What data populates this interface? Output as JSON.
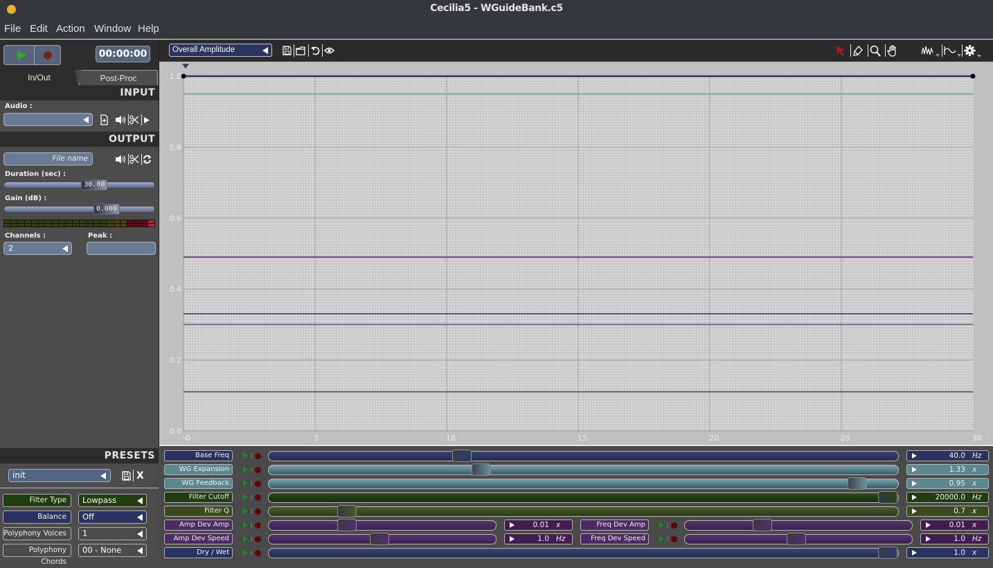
{
  "window": {
    "title": "Cecilia5 - WGuideBank.c5"
  },
  "menu": [
    "File",
    "Edit",
    "Action",
    "Window",
    "Help"
  ],
  "transport": {
    "time": "00:00:00",
    "play_icon": "play-icon",
    "record_icon": "record-icon"
  },
  "tabs": [
    {
      "label": "In/Out",
      "active": true
    },
    {
      "label": "Post-Proc",
      "active": false
    }
  ],
  "input": {
    "header": "INPUT",
    "audio_label": "Audio :",
    "audio_value": ""
  },
  "output": {
    "header": "OUTPUT",
    "filename_placeholder": "File name",
    "duration_label": "Duration (sec) :",
    "duration_value": "30.00",
    "duration_position": 0.6,
    "gain_label": "Gain (dB) :",
    "gain_value": "0.000",
    "gain_position": 0.68,
    "channels_label": "Channels :",
    "channels_value": "2",
    "peak_label": "Peak :",
    "peak_value": ""
  },
  "graph": {
    "selector": "Overall Amplitude",
    "xlim": [
      0,
      30
    ],
    "ylim": [
      0,
      1
    ],
    "x_ticks": [
      {
        "v": 0,
        "label": "-0"
      },
      {
        "v": 5,
        "label": "5"
      },
      {
        "v": 10,
        "label": "10"
      },
      {
        "v": 15,
        "label": "15"
      },
      {
        "v": 20,
        "label": "20"
      },
      {
        "v": 25,
        "label": "25"
      },
      {
        "v": 30,
        "label": "30"
      }
    ],
    "y_ticks": [
      {
        "v": 1.0,
        "label": "1.0"
      },
      {
        "v": 0.8,
        "label": "0.8"
      },
      {
        "v": 0.6,
        "label": "0.6"
      },
      {
        "v": 0.4,
        "label": "0.4"
      },
      {
        "v": 0.2,
        "label": "0.2"
      },
      {
        "v": 0.0,
        "label": "0.0"
      }
    ],
    "lines": [
      {
        "name": "overall-amplitude",
        "value": 1.0,
        "color": "#2e3462",
        "endpoints": true
      },
      {
        "name": "wg-feedback",
        "value": 0.95,
        "color": "#86a4ac",
        "endpoints": false
      },
      {
        "name": "purple-line",
        "value": 0.49,
        "color": "#6c4a80",
        "endpoints": false
      },
      {
        "name": "slate-line-1",
        "value": 0.33,
        "color": "#505a78",
        "endpoints": false
      },
      {
        "name": "slate-line-2",
        "value": 0.3,
        "color": "#6a6e92",
        "endpoints": false
      },
      {
        "name": "olive-line",
        "value": 0.11,
        "color": "#5b6a45",
        "endpoints": false
      }
    ]
  },
  "presets": {
    "header": "PRESETS",
    "value": "init",
    "delete_label": "X"
  },
  "widgets": [
    {
      "label": "Filter Type",
      "value": "Lowpass",
      "theme": "green"
    },
    {
      "label": "Balance",
      "value": "Off",
      "theme": "navy"
    },
    {
      "label": "Polyphony Voices",
      "value": "1",
      "theme": "none"
    },
    {
      "label": "Polyphony Chords",
      "value": "00 - None",
      "theme": "none"
    }
  ],
  "sliders": {
    "rows": [
      [
        {
          "label": "Base Freq",
          "value": "40.0",
          "unit": "Hz",
          "position": 0.307,
          "theme": "navy"
        }
      ],
      [
        {
          "label": "WG Expansion",
          "value": "1.33",
          "unit": "x",
          "position": 0.337,
          "theme": "teal"
        }
      ],
      [
        {
          "label": "WG Feedback",
          "value": "0.95",
          "unit": "x",
          "position": 0.936,
          "theme": "teal"
        }
      ],
      [
        {
          "label": "Filter Cutoff",
          "value": "20000.0",
          "unit": "Hz",
          "position": 0.985,
          "theme": "green"
        }
      ],
      [
        {
          "label": "Filter Q",
          "value": "0.7",
          "unit": "x",
          "position": 0.124,
          "theme": "olive"
        }
      ],
      [
        {
          "label": "Amp Dev Amp",
          "value": "0.01",
          "unit": "x",
          "position": 0.345,
          "theme": "purple"
        },
        {
          "label": "Freq Dev Amp",
          "value": "0.01",
          "unit": "x",
          "position": 0.342,
          "theme": "purple"
        }
      ],
      [
        {
          "label": "Amp Dev Speed",
          "value": "1.0",
          "unit": "Hz",
          "position": 0.488,
          "theme": "purple"
        },
        {
          "label": "Freq Dev Speed",
          "value": "1.0",
          "unit": "Hz",
          "position": 0.49,
          "theme": "purple"
        }
      ],
      [
        {
          "label": "Dry / Wet",
          "value": "1.0",
          "unit": "x",
          "position": 0.985,
          "theme": "navy"
        }
      ]
    ]
  }
}
